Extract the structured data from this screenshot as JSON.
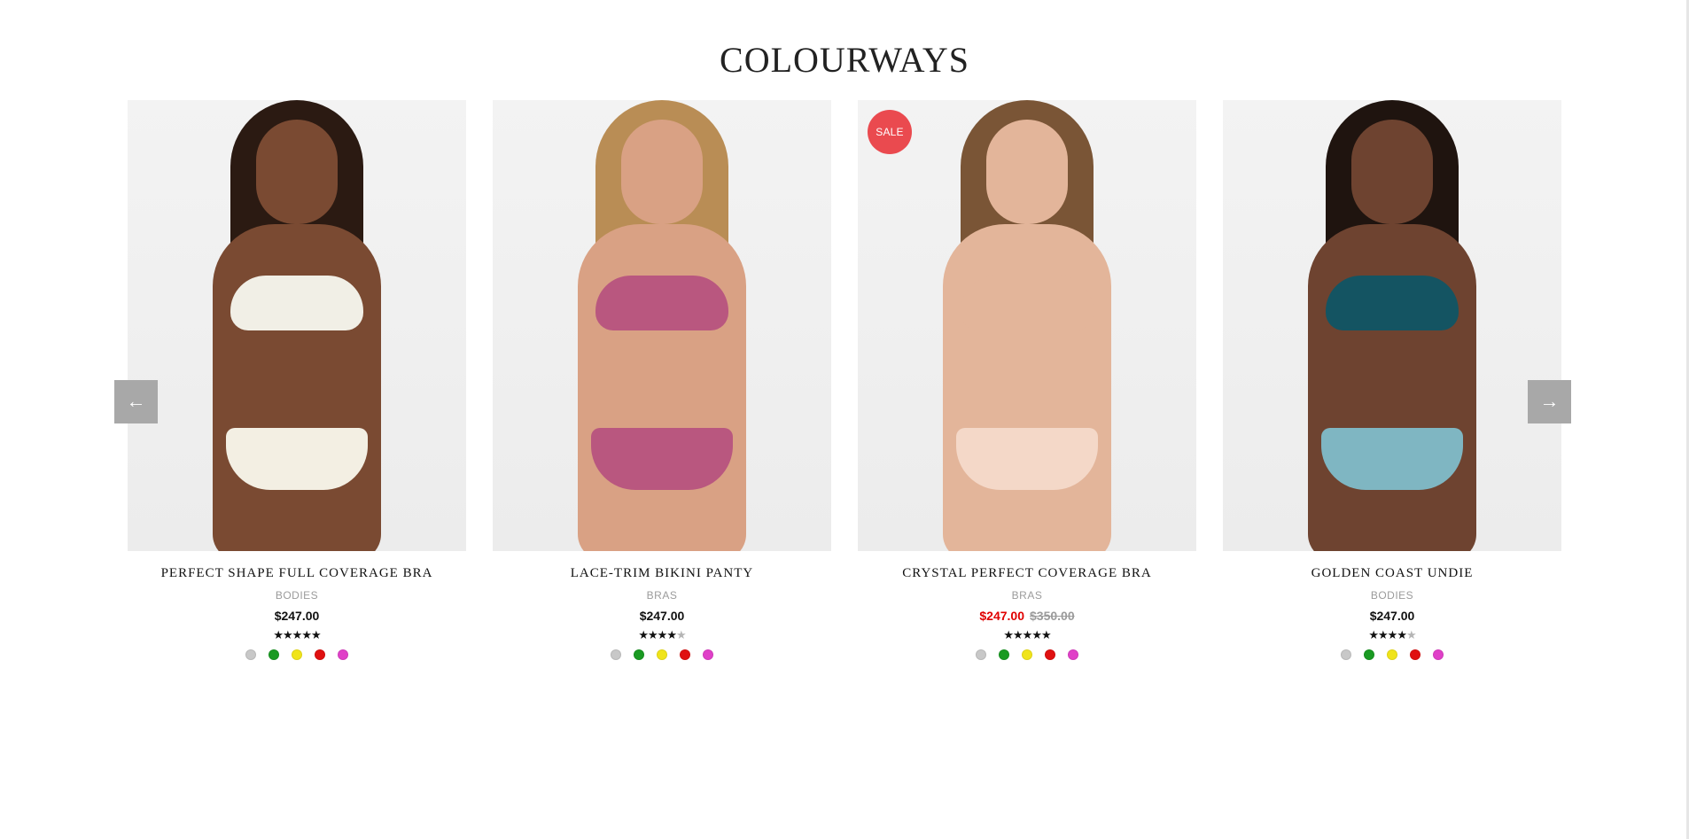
{
  "section": {
    "title": "COLOURWAYS"
  },
  "navigation": {
    "prev_icon": "←",
    "next_icon": "→"
  },
  "swatch_colors": [
    "#c8c8c8",
    "#1a9a22",
    "#f0e41a",
    "#e01010",
    "#e040c8"
  ],
  "products": [
    {
      "name": "PERFECT SHAPE FULL COVERAGE BRA",
      "category": "BODIES",
      "price": "$247.00",
      "original_price": "",
      "sale": false,
      "sale_label": "",
      "rating": 5,
      "stars": "★★★★★",
      "stars_empty": "",
      "colors": {
        "skin": "#7a4a32",
        "hair": "#2b1a12",
        "top": "#f1efe6",
        "bottom": "#f3efe3"
      }
    },
    {
      "name": "LACE-TRIM BIKINI PANTY",
      "category": "BRAS",
      "price": "$247.00",
      "original_price": "",
      "sale": false,
      "sale_label": "",
      "rating": 4,
      "stars": "★★★★",
      "stars_empty": "★",
      "colors": {
        "skin": "#d9a184",
        "hair": "#b98d55",
        "top": "#b9577f",
        "bottom": "#b9577f"
      }
    },
    {
      "name": "CRYSTAL PERFECT COVERAGE BRA",
      "category": "BRAS",
      "price": "$247.00",
      "original_price": "$350.00",
      "sale": true,
      "sale_label": "SALE",
      "rating": 5,
      "stars": "★★★★★",
      "stars_empty": "",
      "colors": {
        "skin": "#e3b59a",
        "hair": "#7a5536",
        "top": "#e3b59a",
        "bottom": "#f4d8c8"
      }
    },
    {
      "name": "GOLDEN COAST UNDIE",
      "category": "BODIES",
      "price": "$247.00",
      "original_price": "",
      "sale": false,
      "sale_label": "",
      "rating": 4,
      "stars": "★★★★",
      "stars_empty": "★",
      "colors": {
        "skin": "#6e4330",
        "hair": "#1f140f",
        "top": "#145462",
        "bottom": "#7fb6c2"
      }
    }
  ]
}
